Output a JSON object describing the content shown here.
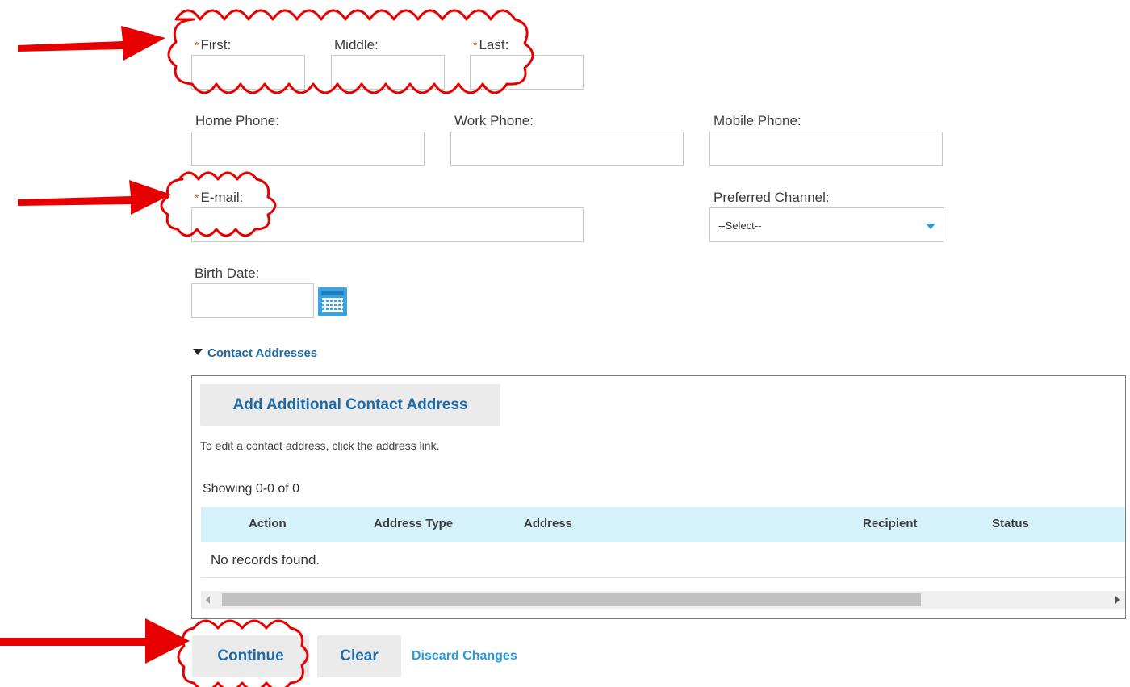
{
  "name_fields": {
    "first_label": "First:",
    "middle_label": "Middle:",
    "last_label": "Last:",
    "required_marker": "*"
  },
  "phone_fields": {
    "home_label": "Home Phone:",
    "work_label": "Work Phone:",
    "mobile_label": "Mobile Phone:"
  },
  "email": {
    "label": "E-mail:"
  },
  "preferred_channel": {
    "label": "Preferred Channel:",
    "selected": "--Select--"
  },
  "birth_date": {
    "label": "Birth Date:"
  },
  "contact_addresses": {
    "section_title": "Contact Addresses",
    "add_button": "Add Additional Contact Address",
    "hint": "To edit a contact address, click the address link.",
    "showing": "Showing 0-0 of 0",
    "columns": [
      "Action",
      "Address Type",
      "Address",
      "Recipient",
      "Status"
    ],
    "empty_message": "No records found."
  },
  "actions": {
    "continue": "Continue",
    "clear": "Clear",
    "discard": "Discard Changes"
  },
  "colors": {
    "annotation": "#e60000",
    "link": "#1e6aa6",
    "required": "#c0651c",
    "table_header": "#d6f3fb"
  },
  "icons": {
    "calendar": "calendar-icon",
    "dropdown": "chevron-down-icon",
    "collapse": "triangle-down-icon"
  }
}
